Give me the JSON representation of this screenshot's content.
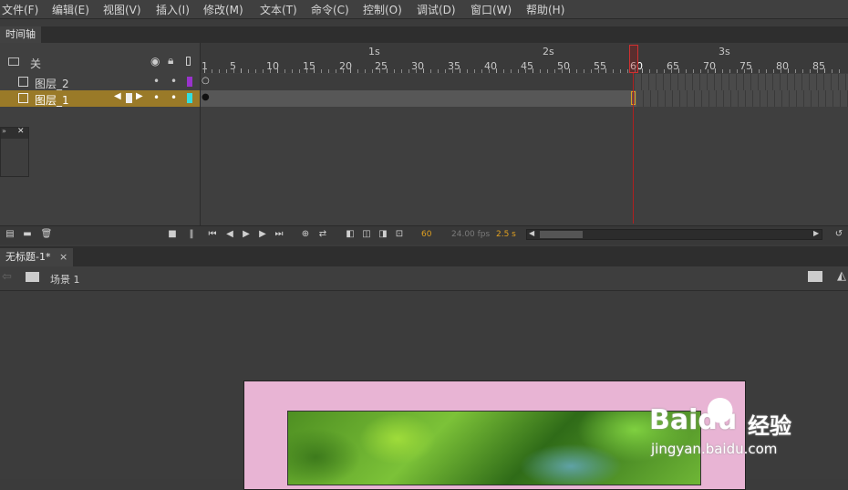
{
  "menu": [
    "文件(F)",
    "编辑(E)",
    "视图(V)",
    "插入(I)",
    "修改(M)",
    "文本(T)",
    "命令(C)",
    "控制(O)",
    "调试(D)",
    "窗口(W)",
    "帮助(H)"
  ],
  "timeline": {
    "tab_label": "时间轴",
    "header_label": "关",
    "seconds": [
      "1s",
      "2s",
      "3s"
    ],
    "frames": [
      "1",
      "5",
      "10",
      "15",
      "20",
      "25",
      "30",
      "35",
      "40",
      "45",
      "50",
      "55",
      "60",
      "65",
      "70",
      "75",
      "80",
      "85"
    ],
    "layers": [
      {
        "name": "图层_2",
        "color": "#9933cc",
        "selected": false
      },
      {
        "name": "图层_1",
        "color": "#33dddd",
        "selected": true
      }
    ],
    "current_frame": "60",
    "fps": "24.00 fps",
    "elapsed": "2.5 s"
  },
  "document": {
    "tab_label": "无标题-1*",
    "close": "×",
    "scene": "场景 1"
  },
  "watermark": {
    "brand": "Baidu",
    "suffix": "经验",
    "url": "jingyan.baidu.com"
  },
  "colors": {
    "selected_layer": "#9a7a28",
    "playhead": "#c02020",
    "stage_bg": "#e8b4d4",
    "accent_frame": "#e0a020"
  }
}
